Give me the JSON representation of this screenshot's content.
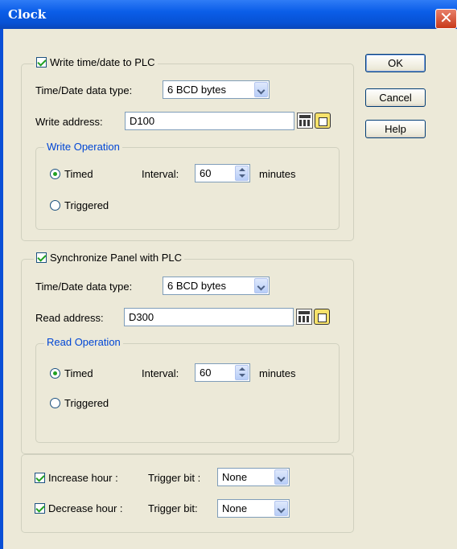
{
  "window": {
    "title": "Clock",
    "close_glyph": "✕"
  },
  "buttons": {
    "ok": "OK",
    "cancel": "Cancel",
    "help": "Help"
  },
  "write_group": {
    "checkbox_label": "Write time/date to PLC",
    "checked": true,
    "data_type_label": "Time/Date data type:",
    "data_type_value": "6 BCD bytes",
    "address_label": "Write address:",
    "address_value": "D100",
    "operation": {
      "legend": "Write Operation",
      "timed_label": "Timed",
      "triggered_label": "Triggered",
      "selected": "Timed",
      "interval_label": "Interval:",
      "interval_value": "60",
      "interval_unit": "minutes"
    }
  },
  "sync_group": {
    "checkbox_label": "Synchronize Panel with PLC",
    "checked": true,
    "data_type_label": "Time/Date data type:",
    "data_type_value": "6 BCD bytes",
    "address_label": "Read address:",
    "address_value": "D300",
    "operation": {
      "legend": "Read Operation",
      "timed_label": "Timed",
      "triggered_label": "Triggered",
      "selected": "Timed",
      "interval_label": "Interval:",
      "interval_value": "60",
      "interval_unit": "minutes"
    }
  },
  "hour_group": {
    "increase_label": "Increase hour :",
    "increase_checked": true,
    "increase_trigger_label": "Trigger bit :",
    "increase_trigger_value": "None",
    "decrease_label": "Decrease hour :",
    "decrease_checked": true,
    "decrease_trigger_label": "Trigger bit:",
    "decrease_trigger_value": "None"
  },
  "colors": {
    "titlebar": "#0b5ee8",
    "dialog_bg": "#ece9d8",
    "legend_blue": "#0046d5",
    "check_green": "#21a121"
  }
}
